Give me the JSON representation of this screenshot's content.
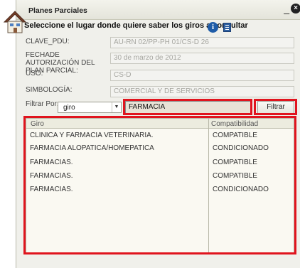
{
  "window": {
    "title": "Planes Parciales",
    "minimize_label": "_",
    "close_label": "×"
  },
  "instructions": "Seleccione el lugar donde quiere saber los giros a consultar",
  "icons": {
    "app": "house-icon",
    "info": "info-icon",
    "document": "document-icon"
  },
  "info_glyph": "i",
  "fields": [
    {
      "label": "CLAVE_PDU:",
      "value": "AU-RN 02/PP-PH 01/CS-D 26"
    },
    {
      "label": "FECHADE AUTORIZACIÓN DEL PLAN PARCIAL:",
      "value": "30 de marzo de 2012"
    },
    {
      "label": "USO:",
      "value": "CS-D"
    },
    {
      "label": "SIMBOLOGÍA:",
      "value": "COMERCIAL Y DE SERVICIOS"
    }
  ],
  "filter": {
    "label": "Filtrar Por:",
    "select_value": "giro",
    "input_value": "FARMACIA",
    "button_label": "Filtrar"
  },
  "grid": {
    "columns": [
      "Giro",
      "Compatibilidad"
    ],
    "rows": [
      [
        "CLINICA Y FARMACIA VETERINARIA.",
        "COMPATIBLE"
      ],
      [
        "FARMACIA ALOPATICA/HOMEPATICA",
        "CONDICIONADO"
      ],
      [
        "FARMACIAS.",
        "COMPATIBLE"
      ],
      [
        "FARMACIAS.",
        "COMPATIBLE"
      ],
      [
        "FARMACIAS.",
        "CONDICIONADO"
      ]
    ]
  },
  "colors": {
    "highlight": "#e0141e",
    "field_text": "#a6a6a0",
    "input_bg": "#e8e2d6"
  }
}
